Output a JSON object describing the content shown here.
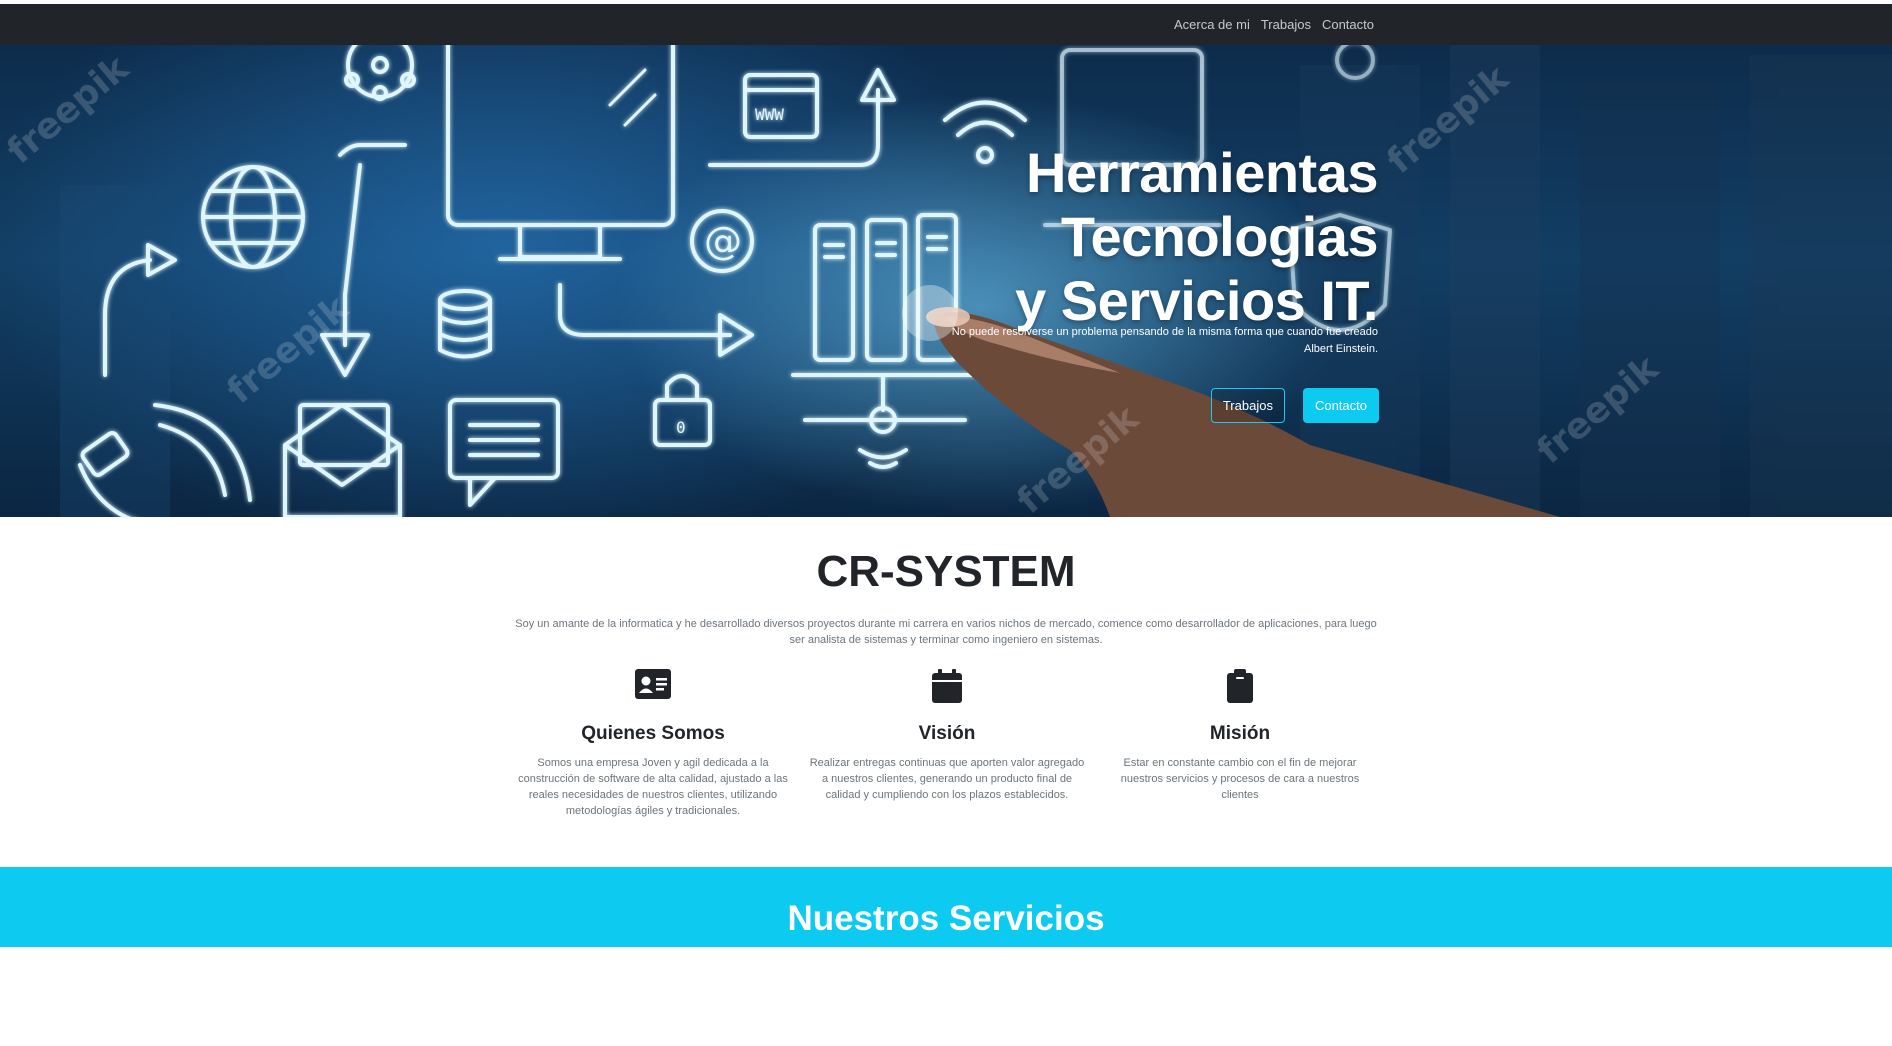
{
  "nav": {
    "items": [
      "Acerca de mi",
      "Trabajos",
      "Contacto"
    ]
  },
  "hero": {
    "title_lines": [
      "Herramientas",
      "Tecnologias",
      "y Servicios IT."
    ],
    "quote": "No puede resolverse un problema pensando de la misma forma que cuando fue creado",
    "author": "Albert Einstein.",
    "buttons": {
      "works": "Trabajos",
      "contact": "Contacto"
    }
  },
  "about": {
    "title": "CR-SYSTEM",
    "intro": "Soy un amante de la informatica y he desarrollado diversos proyectos durante mi carrera en varios nichos de mercado, comence como desarrollador de aplicaciones, para luego ser analista de sistemas y terminar como ingeniero en sistemas.",
    "columns": [
      {
        "icon": "id-card-icon",
        "title": "Quienes Somos",
        "text": "Somos una empresa Joven y agil dedicada a la construcción de software de alta calidad, ajustado a las reales necesidades de nuestros clientes, utilizando metodologías ágiles y tradicionales."
      },
      {
        "icon": "calendar-icon",
        "title": "Visión",
        "text": "Realizar entregas continuas que aporten valor agregado a nuestros clientes, generando un producto final de calidad y cumpliendo con los plazos establecidos."
      },
      {
        "icon": "clipboard-icon",
        "title": "Misión",
        "text": "Estar en constante cambio con el fin de mejorar nuestros servicios y procesos de cara a nuestros clientes"
      }
    ]
  },
  "services": {
    "title": "Nuestros Servicios"
  },
  "colors": {
    "navbar": "#212529",
    "accent": "#0dcaf0",
    "text_dark": "#212529",
    "text_muted": "#6c757d"
  }
}
